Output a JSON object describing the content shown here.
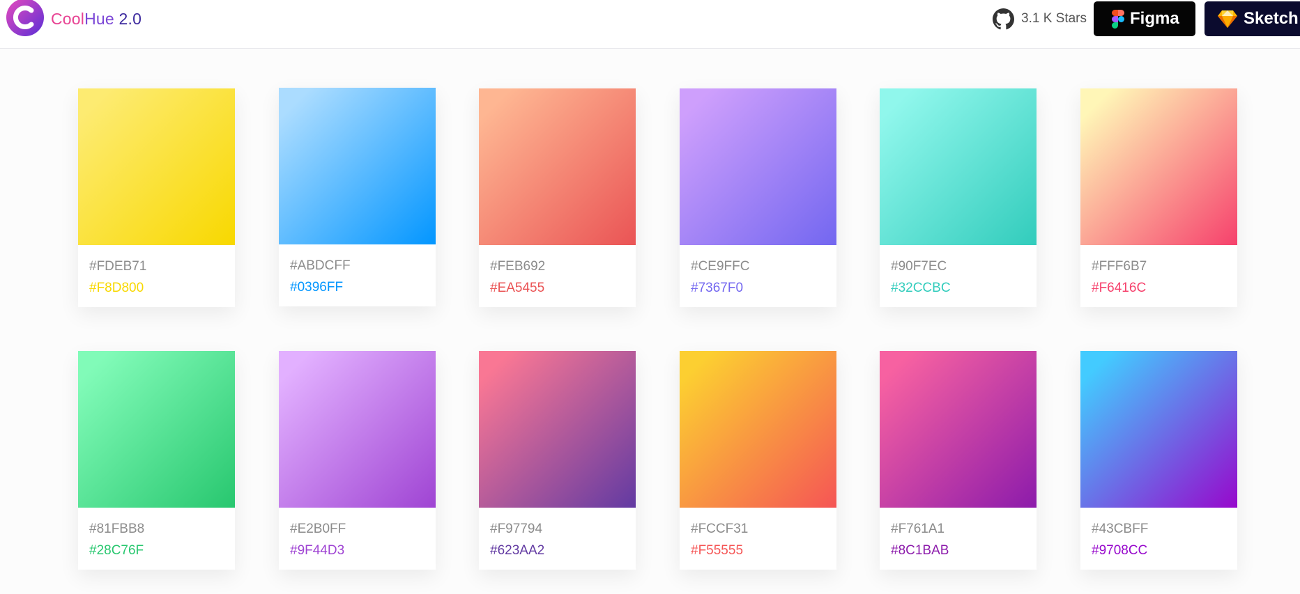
{
  "header": {
    "brand": {
      "part1": "Cool",
      "part2": "Hue",
      "part3": " 2.0"
    },
    "stars_label": "3.1 K Stars",
    "figma_label": "Figma",
    "sketch_label": "Sketch",
    "accent_colors": {
      "cool": "#e84393",
      "hue": "#7b46d6",
      "version": "#3d2a9e"
    }
  },
  "gradients": [
    {
      "start": "#FDEB71",
      "end": "#F8D800"
    },
    {
      "start": "#ABDCFF",
      "end": "#0396FF"
    },
    {
      "start": "#FEB692",
      "end": "#EA5455"
    },
    {
      "start": "#CE9FFC",
      "end": "#7367F0"
    },
    {
      "start": "#90F7EC",
      "end": "#32CCBC"
    },
    {
      "start": "#FFF6B7",
      "end": "#F6416C"
    },
    {
      "start": "#81FBB8",
      "end": "#28C76F"
    },
    {
      "start": "#E2B0FF",
      "end": "#9F44D3"
    },
    {
      "start": "#F97794",
      "end": "#623AA2"
    },
    {
      "start": "#FCCF31",
      "end": "#F55555"
    },
    {
      "start": "#F761A1",
      "end": "#8C1BAB"
    },
    {
      "start": "#43CBFF",
      "end": "#9708CC"
    }
  ]
}
